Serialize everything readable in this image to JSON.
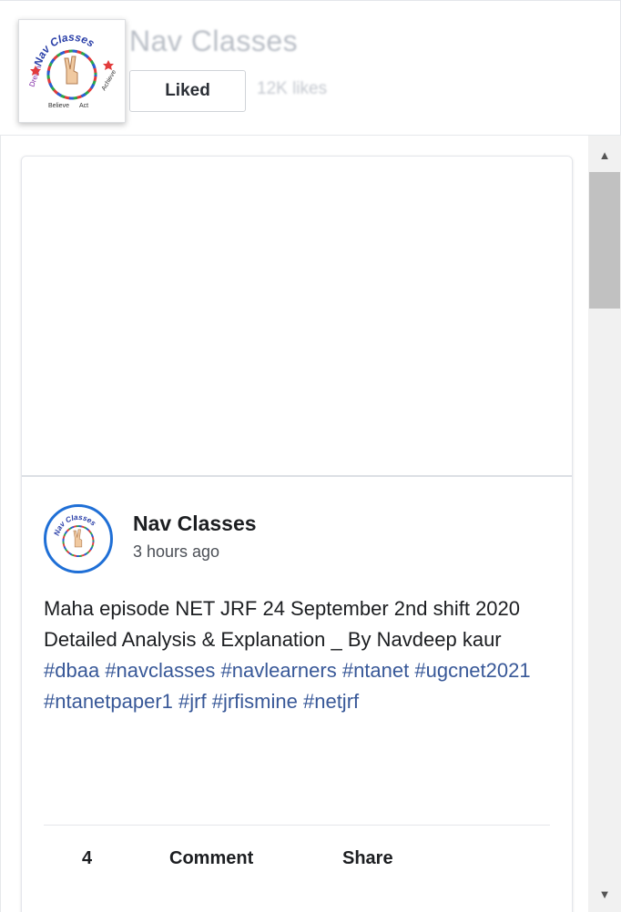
{
  "header": {
    "page_name": "Nav Classes",
    "liked_label": "Liked",
    "likes_count": "12K likes"
  },
  "logo": {
    "arc_text": "Nav Classes",
    "bottom_words": [
      "Dream",
      "Believe",
      "Act",
      "Achieve"
    ]
  },
  "post": {
    "author": "Nav Classes",
    "time": "3 hours ago",
    "text": "Maha episode NET JRF 24 September 2nd shift 2020 Detailed Analysis & Explanation _ By Navdeep kaur",
    "hashtags": [
      "#dbaa",
      "#navclasses",
      "#navlearners",
      "#ntanet",
      "#ugcnet2021",
      "#ntanetpaper1",
      "#jrf",
      "#jrfismine",
      "#netjrf"
    ]
  },
  "actions": {
    "like_count": "4",
    "comment_label": "Comment",
    "share_label": "Share"
  },
  "colors": {
    "link": "#385898",
    "avatar_ring": "#1f6fd6",
    "scrollbar_thumb": "#c1c1c1"
  }
}
